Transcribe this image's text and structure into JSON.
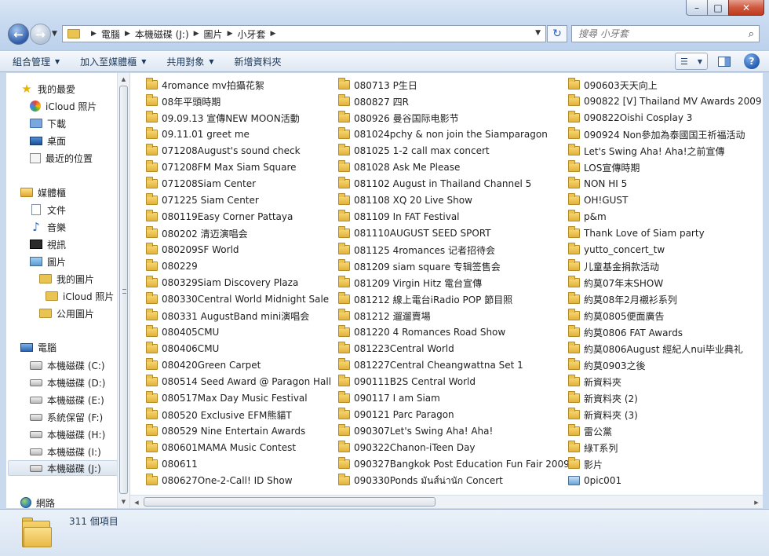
{
  "window": {
    "min_symbol": "–",
    "max_symbol": "□",
    "close_symbol": "✕"
  },
  "nav": {
    "back_symbol": "←",
    "forward_symbol": "→",
    "dropdown_symbol": "▼"
  },
  "address": {
    "separator": "▶",
    "crumbs": [
      "電腦",
      "本機磁碟 (J:)",
      "圖片",
      "小牙套"
    ],
    "dropdown_symbol": "▼",
    "refresh_symbol": "↻"
  },
  "search": {
    "placeholder": "搜尋 小牙套",
    "icon_symbol": "⌕"
  },
  "toolbar": {
    "organize": "組合管理",
    "add_to_media": "加入至媒體櫃",
    "share": "共用對象",
    "new_folder": "新增資料夾",
    "caret": "▼",
    "view_symbol": "☰",
    "help_symbol": "?"
  },
  "navpane": {
    "items": [
      {
        "label": "我的最愛",
        "icon": "star-icon"
      },
      {
        "label": "iCloud 照片",
        "icon": "icloud-icon"
      },
      {
        "label": "下載",
        "icon": "download-folder-icon"
      },
      {
        "label": "桌面",
        "icon": "desktop-icon"
      },
      {
        "label": "最近的位置",
        "icon": "recent-places-icon"
      },
      {
        "label": "媒體櫃",
        "icon": "library-icon"
      },
      {
        "label": "文件",
        "icon": "documents-icon"
      },
      {
        "label": "音樂",
        "icon": "music-icon"
      },
      {
        "label": "視訊",
        "icon": "video-icon"
      },
      {
        "label": "圖片",
        "icon": "pictures-icon"
      },
      {
        "label": "我的圖片",
        "icon": "folder-icon"
      },
      {
        "label": "iCloud 照片",
        "icon": "folder-icon"
      },
      {
        "label": "公用圖片",
        "icon": "folder-icon"
      },
      {
        "label": "電腦",
        "icon": "computer-icon"
      },
      {
        "label": "本機磁碟 (C:)",
        "icon": "windows-drive-icon"
      },
      {
        "label": "本機磁碟 (D:)",
        "icon": "drive-icon"
      },
      {
        "label": "本機磁碟 (E:)",
        "icon": "drive-icon"
      },
      {
        "label": "系統保留 (F:)",
        "icon": "drive-icon"
      },
      {
        "label": "本機磁碟 (H:)",
        "icon": "drive-icon"
      },
      {
        "label": "本機磁碟 (I:)",
        "icon": "drive-icon"
      },
      {
        "label": "本機磁碟 (J:)",
        "icon": "drive-icon",
        "selected": true
      },
      {
        "label": "網路",
        "icon": "network-icon"
      }
    ]
  },
  "files": {
    "col1": [
      "4romance mv拍攝花絮",
      "08年平頭時期",
      "09.09.13 宣傳NEW MOON活動",
      "09.11.01 greet me",
      "071208August's sound check",
      "071208FM Max Siam Square",
      "071208Siam Center",
      "071225 Siam Center",
      "080119Easy Corner Pattaya",
      "080202 清迈演唱会",
      "080209SF World",
      "080229",
      "080329Siam Discovery Plaza",
      "080330Central World Midnight Sale",
      "080331 AugustBand mini演唱会",
      "080405CMU",
      "080406CMU",
      "080420Green Carpet",
      "080514  Seed Award @ Paragon Hall",
      "080517Max Day Music Festival",
      "080520 Exclusive EFM熊貓T",
      "080529 Nine Entertain Awards",
      "080601MAMA Music Contest",
      "080611",
      "080627One-2-Call! ID Show"
    ],
    "col2": [
      "080713  P生日",
      "080827  四R",
      "080926 曼谷国际电影节",
      "081024pchy & non join the Siamparagon",
      "081025 1-2 call max concert",
      "081028 Ask Me Please",
      "081102 August in Thailand Channel 5",
      "081108 XQ 20 Live Show",
      "081109 In FAT Festival",
      "081110AUGUST SEED SPORT",
      "081125 4romances 记者招待会",
      "081209 siam square 专辑签售会",
      "081209 Virgin Hitz 電台宣傳",
      "081212 線上電台iRadio POP 節目照",
      "081212 遛遛賣場",
      "081220 4 Romances Road Show",
      "081223Central World",
      "081227Central Cheangwattna Set 1",
      "090111B2S Central World",
      "090117 I am Siam",
      "090121 Parc Paragon",
      "090307Let's Swing Aha! Aha!",
      "090322Chanon-iTeen Day",
      "090327Bangkok Post Education Fun Fair 2009",
      "090330Ponds มันส์น่านัก Concert"
    ],
    "col3": [
      "090603天天向上",
      "090822 [V] Thailand MV Awards 2009",
      "090822Oishi Cosplay 3",
      "090924 Non參加為泰國国王祈福活动",
      "Let's Swing Aha! Aha!之前宣傳",
      "LOS宣傳時期",
      "NON HI 5",
      "OH!GUST",
      "p&m",
      "Thank Love of Siam party",
      "yutto_concert_tw",
      "儿童基金捐款活动",
      "約莫07年末SHOW",
      "約莫08年2月襯衫系列",
      "約莫0805便面廣告",
      "約莫0806 FAT Awards",
      "約莫0806August 經紀人nui毕业典礼",
      "約莫0903之後",
      "新資料夾",
      "新資料夾 (2)",
      "新資料夾 (3)",
      "雷公黨",
      "綠T系列",
      "影片",
      "0pic001"
    ]
  },
  "status": {
    "item_count": "311 個項目"
  }
}
